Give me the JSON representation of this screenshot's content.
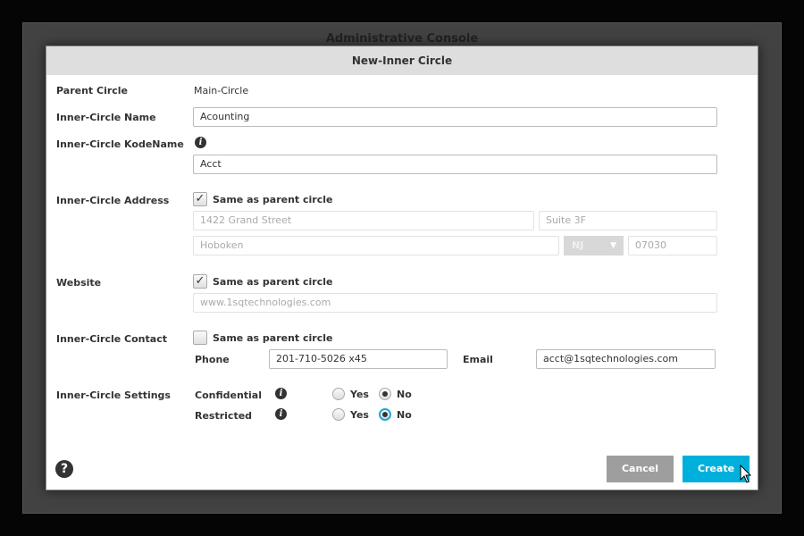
{
  "background": {
    "console_title": "Administrative Console"
  },
  "modal": {
    "title": "New-Inner Circle",
    "parent_circle": {
      "label": "Parent Circle",
      "value": "Main-Circle"
    },
    "name": {
      "label": "Inner-Circle Name",
      "value": "Acounting"
    },
    "kodename": {
      "label": "Inner-Circle KodeName",
      "value": "Acct",
      "icon": "info-icon"
    },
    "address": {
      "label": "Inner-Circle Address",
      "same_label": "Same as parent circle",
      "same_checked": true,
      "street": "1422 Grand Street",
      "suite": "Suite 3F",
      "city": "Hoboken",
      "state": "NJ",
      "zip": "07030"
    },
    "website": {
      "label": "Website",
      "same_label": "Same as parent circle",
      "same_checked": true,
      "value": "www.1sqtechnologies.com"
    },
    "contact": {
      "label": "Inner-Circle Contact",
      "same_label": "Same as parent circle",
      "same_checked": false,
      "phone_label": "Phone",
      "phone": "201-710-5026 x45",
      "email_label": "Email",
      "email": "acct@1sqtechnologies.com"
    },
    "settings": {
      "label": "Inner-Circle Settings",
      "confidential": {
        "label": "Confidential",
        "yes": "Yes",
        "no": "No",
        "selected": "No"
      },
      "restricted": {
        "label": "Restricted",
        "yes": "Yes",
        "no": "No",
        "selected": "No"
      }
    },
    "help_icon": "question-circle-icon",
    "cancel_label": "Cancel",
    "create_label": "Create",
    "colors": {
      "primary": "#00b0dc",
      "cancel": "#9e9e9e",
      "header": "#dedede"
    }
  }
}
